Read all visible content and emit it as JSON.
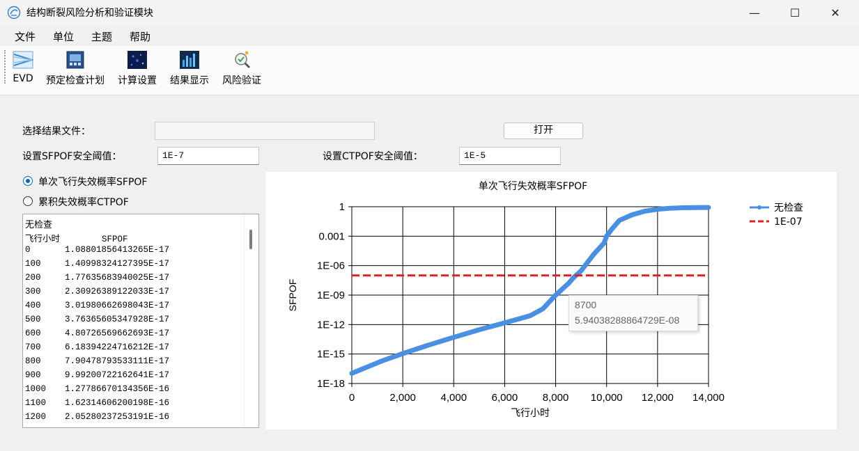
{
  "window": {
    "title": "结构断裂风险分析和验证模块",
    "minimize_glyph": "—",
    "maximize_glyph": "☐",
    "close_glyph": "✕"
  },
  "menu": [
    "文件",
    "单位",
    "主题",
    "帮助"
  ],
  "toolbar": [
    {
      "label": "EVD",
      "icon": "evd-icon"
    },
    {
      "label": "预定检查计划",
      "icon": "inspection-plan-icon"
    },
    {
      "label": "计算设置",
      "icon": "calc-settings-icon"
    },
    {
      "label": "结果显示",
      "icon": "result-display-icon"
    },
    {
      "label": "风险验证",
      "icon": "risk-verify-icon"
    }
  ],
  "form": {
    "result_file_label": "选择结果文件：",
    "result_file_value": "",
    "open_button": "打开",
    "sfpof_threshold_label": "设置SFPOF安全阈值：",
    "sfpof_threshold_value": "1E-7",
    "ctpof_threshold_label": "设置CTPOF安全阈值：",
    "ctpof_threshold_value": "1E-5"
  },
  "radios": [
    {
      "label": "单次飞行失效概率SFPOF",
      "selected": true
    },
    {
      "label": "累积失效概率CTPOF",
      "selected": false
    }
  ],
  "listbox": {
    "title": "无检查",
    "header": "飞行小时        SFPOF",
    "rows": [
      {
        "hours": "0",
        "value": "1.08801856413265E-17"
      },
      {
        "hours": "100",
        "value": "1.40998324127395E-17"
      },
      {
        "hours": "200",
        "value": "1.77635683940025E-17"
      },
      {
        "hours": "300",
        "value": "2.30926389122033E-17"
      },
      {
        "hours": "400",
        "value": "3.01980662698043E-17"
      },
      {
        "hours": "500",
        "value": "3.76365605347928E-17"
      },
      {
        "hours": "600",
        "value": "4.80726569662693E-17"
      },
      {
        "hours": "700",
        "value": "6.18394224716212E-17"
      },
      {
        "hours": "800",
        "value": "7.90478793533111E-17"
      },
      {
        "hours": "900",
        "value": "9.99200722162641E-17"
      },
      {
        "hours": "1000",
        "value": "1.27786670134356E-16"
      },
      {
        "hours": "1100",
        "value": "1.62314606200198E-16"
      },
      {
        "hours": "1200",
        "value": "2.05280237253191E-16"
      }
    ]
  },
  "tooltip": {
    "x_value": "8700",
    "y_value": "5.94038288864729E-08"
  },
  "chart_data": {
    "type": "line",
    "title": "单次飞行失效概率SFPOF",
    "xlabel": "飞行小时",
    "ylabel": "SFPOF",
    "x_scale": "linear",
    "y_scale": "log",
    "xlim": [
      0,
      14000
    ],
    "ylim": [
      1e-18,
      1
    ],
    "x_ticks": [
      "0",
      "2,000",
      "4,000",
      "6,000",
      "8,000",
      "10,000",
      "12,000",
      "14,000"
    ],
    "y_ticks": [
      "1",
      "0.001",
      "1E-06",
      "1E-09",
      "1E-12",
      "1E-15",
      "1E-18"
    ],
    "grid": true,
    "legend_position": "top-right",
    "series": [
      {
        "name": "无检查",
        "color": "#4a90e2",
        "x": [
          0,
          1200,
          2000,
          3000,
          4000,
          5000,
          6000,
          7000,
          7500,
          8000,
          8500,
          8700,
          9000,
          9500,
          9900,
          10000,
          10200,
          10500,
          11000,
          11500,
          12000,
          12500,
          13000,
          13500,
          14000
        ],
        "y": [
          1.09e-17,
          2.05e-16,
          1.1e-15,
          8e-15,
          5e-14,
          3e-13,
          1.5e-12,
          8e-12,
          4e-11,
          1e-09,
          1.5e-08,
          5.94e-08,
          3e-07,
          1.5e-05,
          0.0002,
          0.001,
          0.005,
          0.04,
          0.15,
          0.35,
          0.55,
          0.7,
          0.78,
          0.82,
          0.84
        ]
      },
      {
        "name": "1E-07",
        "color": "#e02020",
        "dashed": true,
        "x": [
          0,
          14000
        ],
        "y": [
          1e-07,
          1e-07
        ]
      }
    ]
  }
}
